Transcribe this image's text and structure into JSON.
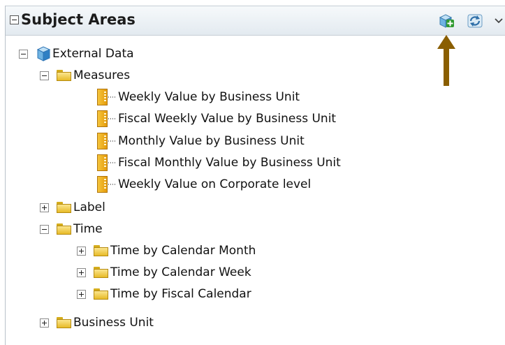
{
  "panel": {
    "title": "Subject Areas",
    "toolbar": {
      "add_icon": "add-subject-area-icon",
      "refresh_icon": "refresh-icon",
      "dropdown_icon": "chevron-down-icon"
    }
  },
  "tree": {
    "root": "External Data",
    "measures_folder": "Measures",
    "measures": [
      "Weekly Value by Business Unit",
      "Fiscal Weekly Value by Business Unit",
      "Monthly Value by Business Unit",
      "Fiscal Monthly Value by Business Unit",
      "Weekly Value on Corporate level"
    ],
    "label_folder": "Label",
    "time_folder": "Time",
    "time_children": [
      "Time by Calendar Month",
      "Time by Calendar Week",
      "Time by Fiscal Calendar"
    ],
    "business_unit_folder": "Business Unit"
  },
  "annotation": {
    "arrow_color": "#8a5e00"
  }
}
